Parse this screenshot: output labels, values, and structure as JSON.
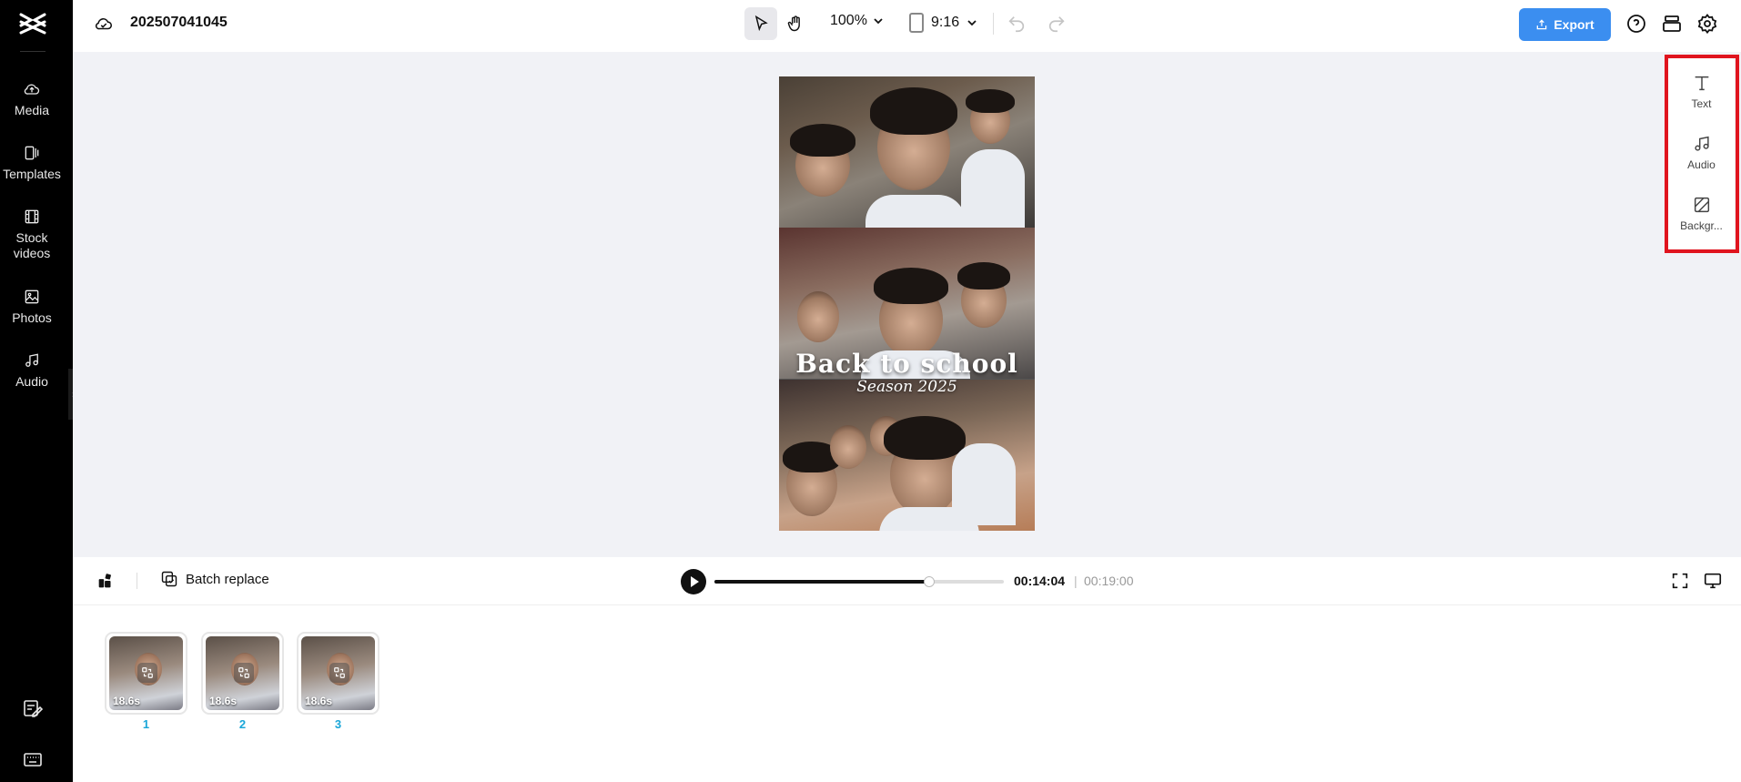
{
  "app": {
    "project_title": "202507041045"
  },
  "sidebar": {
    "items": [
      {
        "label": "Media",
        "icon": "cloud-upload-icon"
      },
      {
        "label": "Templates",
        "icon": "templates-icon"
      },
      {
        "label": "Stock\nvideos",
        "icon": "film-icon"
      },
      {
        "label": "Photos",
        "icon": "image-icon"
      },
      {
        "label": "Audio",
        "icon": "music-note-icon"
      }
    ],
    "bottom_icons": [
      "edit-notes-icon",
      "keyboard-icon"
    ]
  },
  "toolbar": {
    "zoom": "100%",
    "ratio": "9:16",
    "export_label": "Export",
    "accent_color": "#3b8ef0"
  },
  "preview": {
    "title": "Back to school",
    "subtitle": "Season 2025"
  },
  "right_panel": {
    "items": [
      {
        "label": "Text",
        "icon": "text-icon"
      },
      {
        "label": "Audio",
        "icon": "music-note-icon"
      },
      {
        "label": "Backgr...",
        "icon": "background-icon"
      }
    ],
    "highlight_color": "#e0141e"
  },
  "player": {
    "batch_replace_label": "Batch replace",
    "current_time": "00:14:04",
    "separator": "|",
    "total_time": "00:19:00",
    "progress_fraction": 0.741
  },
  "clips": [
    {
      "duration": "18.6s",
      "number": "1"
    },
    {
      "duration": "18.6s",
      "number": "2"
    },
    {
      "duration": "18.6s",
      "number": "3"
    }
  ]
}
